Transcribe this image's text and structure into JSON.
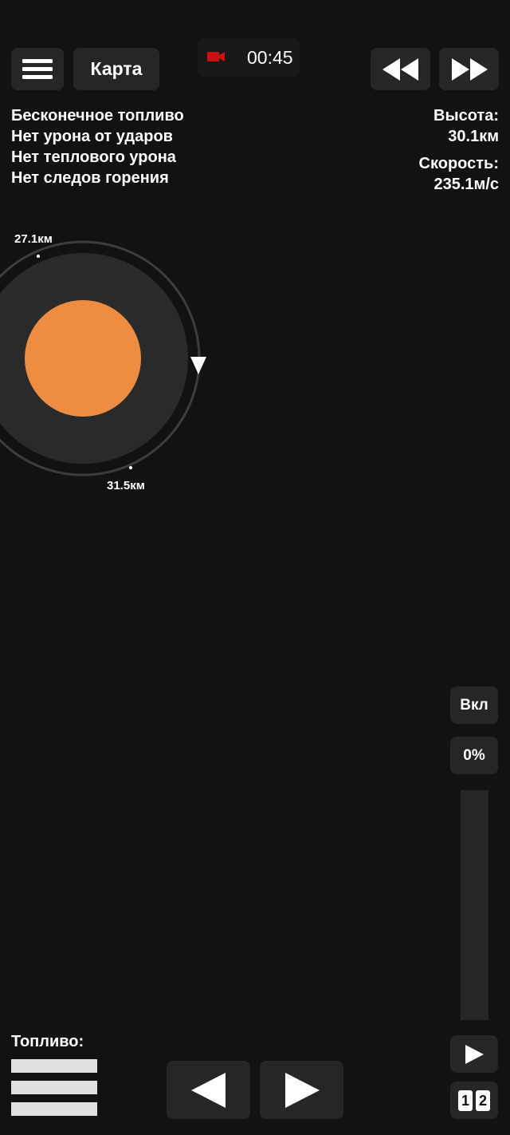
{
  "header": {
    "map_label": "Карта",
    "timer": "00:45",
    "record_color": "#cc1111"
  },
  "cheats": [
    "Бесконечное топливо",
    "Нет урона от ударов",
    "Нет теплового урона",
    "Нет следов горения"
  ],
  "telemetry": {
    "altitude_label": "Высота:",
    "altitude_value": "30.1км",
    "speed_label": "Скорость:",
    "speed_value": "235.1м/с"
  },
  "orbit": {
    "apoapsis_label": "27.1км",
    "periapsis_label": "31.5км",
    "planet_color": "#ee8c41"
  },
  "throttle": {
    "toggle_label": "Вкл",
    "percent_label": "0%",
    "level": 0
  },
  "fuel": {
    "label": "Топливо:"
  },
  "stage": {
    "digit_1": "1",
    "digit_2": "2"
  }
}
